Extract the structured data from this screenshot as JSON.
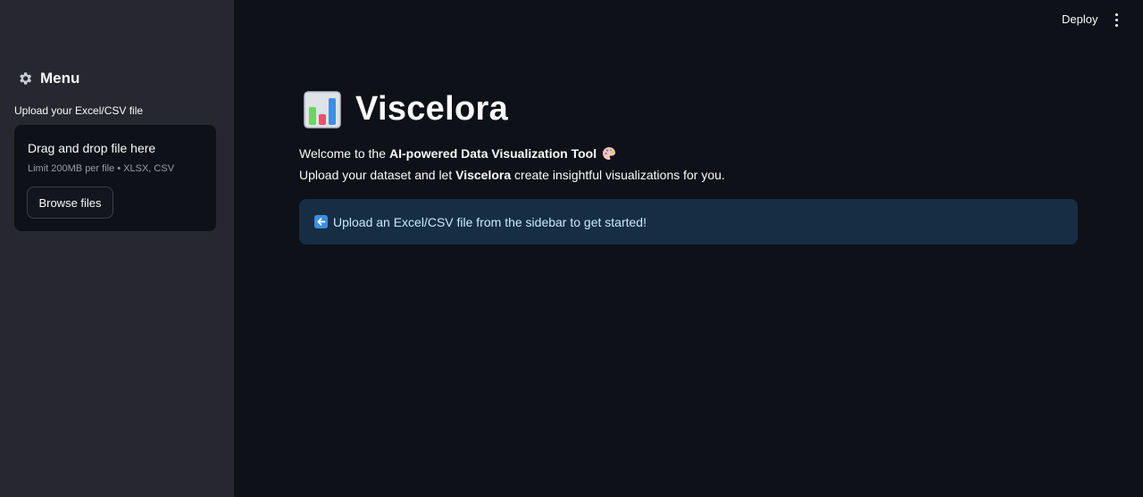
{
  "sidebar": {
    "menu_title": "Menu",
    "menu_icon": "gear-icon",
    "upload_label": "Upload your Excel/CSV file",
    "dropzone": {
      "title": "Drag and drop file here",
      "limit": "Limit 200MB per file • XLSX, CSV",
      "browse_label": "Browse files"
    }
  },
  "header": {
    "deploy_label": "Deploy",
    "menu_icon": "kebab-menu-icon"
  },
  "main": {
    "title": "Viscelora",
    "title_icon": "bar-chart-icon",
    "welcome_prefix": "Welcome to the",
    "welcome_bold": "AI-powered Data Visualization Tool",
    "welcome_icon": "palette-icon",
    "sub_prefix": "Upload your dataset and let",
    "sub_bold": "Viscelora",
    "sub_suffix": "create insightful visualizations for you.",
    "info_icon": "left-arrow-icon",
    "info_message": "Upload an Excel/CSV file from the sidebar to get started!"
  },
  "colors": {
    "background": "#0e1117",
    "sidebar": "#262730",
    "info_bg": "#172d43",
    "info_text": "#c7ebff"
  }
}
